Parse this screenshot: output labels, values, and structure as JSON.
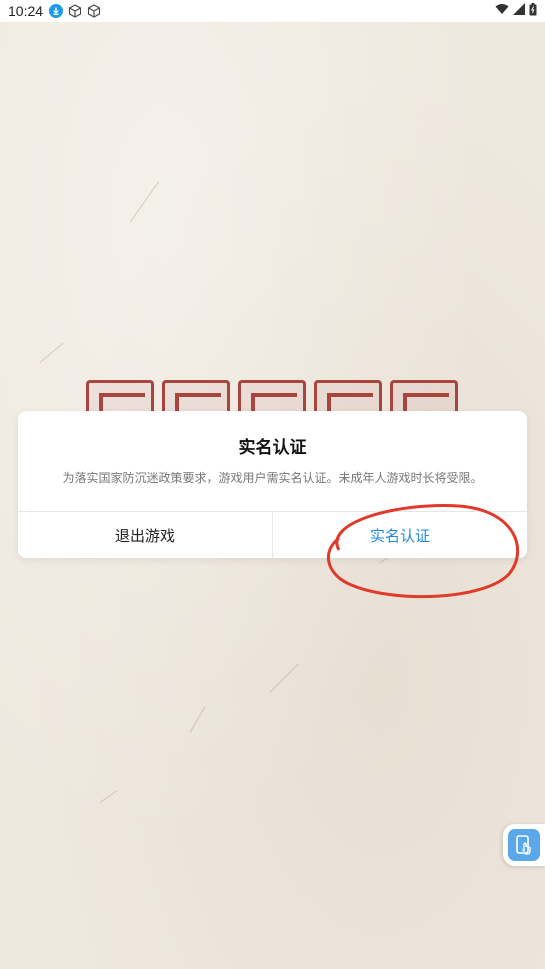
{
  "status_bar": {
    "time": "10:24",
    "left_icons": [
      "download-icon",
      "box-icon",
      "box-icon"
    ],
    "right_icons": [
      "wifi-icon",
      "signal-icon",
      "battery-icon"
    ]
  },
  "background": {
    "banner_icon": "game-title-seal-icon"
  },
  "dialog": {
    "title": "实名认证",
    "message": "为落实国家防沉迷政策要求，游戏用户需实名认证。未成年人游戏时长将受限。",
    "cancel_label": "退出游戏",
    "confirm_label": "实名认证"
  },
  "annotation": {
    "color": "#e03a2a",
    "shape": "ellipse"
  },
  "floating_widget": {
    "icon": "phone-touch-icon"
  },
  "colors": {
    "primary": "#1e8be0",
    "stamp": "#a8453f",
    "paper": "#efe8df"
  }
}
